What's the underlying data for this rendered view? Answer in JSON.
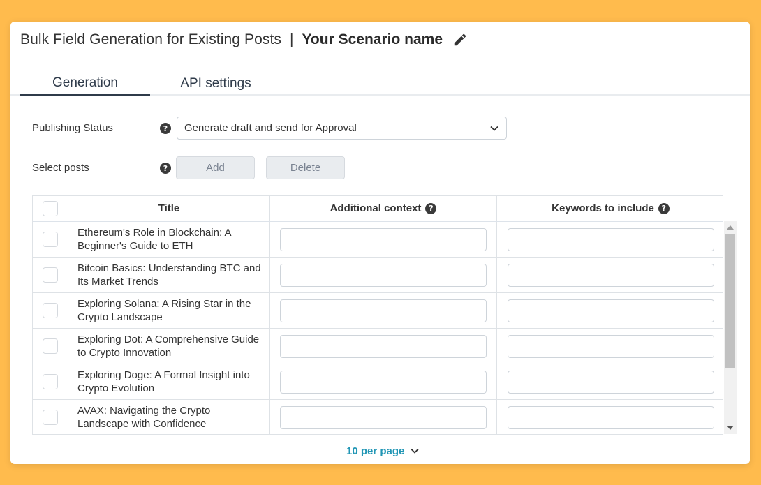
{
  "header": {
    "page_title": "Bulk Field Generation for Existing Posts",
    "separator": "|",
    "scenario_name": "Your Scenario name",
    "edit_icon": "pencil-icon"
  },
  "tabs": [
    {
      "label": "Generation",
      "active": true
    },
    {
      "label": "API settings",
      "active": false
    }
  ],
  "form": {
    "publishing_status_label": "Publishing Status",
    "publishing_status_value": "Generate draft and send for Approval",
    "select_posts_label": "Select posts",
    "add_label": "Add",
    "delete_label": "Delete",
    "help_glyph": "?"
  },
  "table": {
    "columns": {
      "title": "Title",
      "context": "Additional context",
      "keywords": "Keywords to include"
    },
    "rows": [
      {
        "title": "Ethereum's Role in Blockchain: A Beginner's Guide to ETH",
        "context": "",
        "keywords": ""
      },
      {
        "title": "Bitcoin Basics: Understanding BTC and Its Market Trends",
        "context": "",
        "keywords": ""
      },
      {
        "title": "Exploring Solana: A Rising Star in the Crypto Landscape",
        "context": "",
        "keywords": ""
      },
      {
        "title": "Exploring Dot: A Comprehensive Guide to Crypto Innovation",
        "context": "",
        "keywords": ""
      },
      {
        "title": "Exploring Doge: A Formal Insight into Crypto Evolution",
        "context": "",
        "keywords": ""
      },
      {
        "title": "AVAX: Navigating the Crypto Landscape with Confidence",
        "context": "",
        "keywords": ""
      }
    ]
  },
  "pagination": {
    "per_page_label": "10 per page"
  },
  "colors": {
    "background": "#ffbb4d",
    "accent": "#2196b5",
    "tab_active": "#2f3b4a"
  }
}
